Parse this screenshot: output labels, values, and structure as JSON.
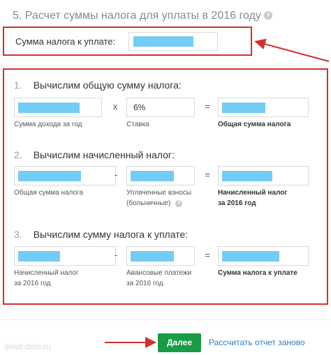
{
  "header": {
    "title": "5. Расчет суммы налога для уплаты в 2016 году",
    "info_icon": "?"
  },
  "summary": {
    "label": "Сумма налога к уплате:"
  },
  "steps": [
    {
      "num": "1.",
      "title": "Вычислим общую сумму налога:",
      "op1": "x",
      "op2": "=",
      "field2_value": "6%",
      "captions": [
        "Сумма дохода за год",
        "Ставка",
        "Общая сумма налога"
      ]
    },
    {
      "num": "2.",
      "title": "Вычислим начисленный налог:",
      "op1": "-",
      "op2": "=",
      "captions": [
        "Общая сумма налога",
        "Уплаченные взносы",
        "(больничные)",
        "Начисленный налог",
        "за 2016 год"
      ]
    },
    {
      "num": "3.",
      "title": "Вычислим сумму налога к уплате:",
      "op1": "-",
      "op2": "=",
      "captions": [
        "Начисленный налог",
        "за 2016 год",
        "Авансовые платежи",
        "за 2016 год",
        "Сумма налога к уплате"
      ]
    }
  ],
  "footer": {
    "next_label": "Далее",
    "reset_label": "Рассчитать отчет заново",
    "watermark": "delat-delo.ru"
  },
  "colors": {
    "highlight_border": "#d32f2f",
    "redacted_fill": "#73ccf4",
    "primary_button": "#179c45",
    "link": "#2b7fc0"
  }
}
